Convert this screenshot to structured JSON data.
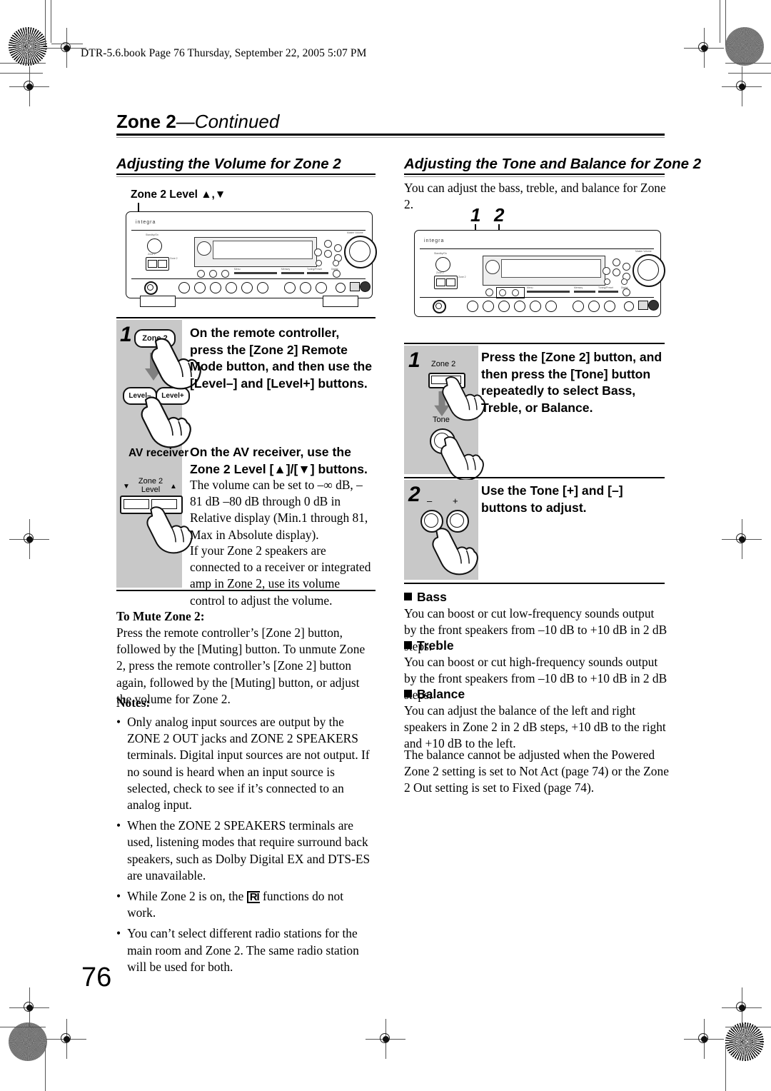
{
  "page": {
    "file_header": "DTR-5.6.book  Page 76  Thursday, September 22, 2005  5:07 PM",
    "chapter_title_bold": "Zone 2",
    "chapter_title_italic": "—Continued",
    "page_number": "76"
  },
  "left_column": {
    "section_title": "Adjusting the Volume for Zone 2",
    "figure_callout": "Zone 2 Level ▲,▼",
    "receiver_logo": "integra",
    "step1": {
      "number": "1",
      "remote_button_top": "Zone 2",
      "remote_button_left": "Level–",
      "remote_button_right": "Level+",
      "device_label": "AV receiver",
      "receiver_button_label_line1": "Zone 2",
      "receiver_button_label_line2": "Level",
      "receiver_button_down": "▼",
      "receiver_button_up": "▲",
      "instruction_remote": "On the remote controller, press the [Zone 2] Remote Mode button, and then use the [Level–] and [Level+] buttons.",
      "instruction_receiver": "On the AV receiver, use the Zone 2 Level [▲]/[▼] buttons.",
      "detail_paragraph_1": "The volume can be set to –∞ dB, –81 dB –80 dB through 0 dB in Relative display (Min.1 through 81, Max in Absolute display).",
      "detail_paragraph_2": "If your Zone 2 speakers are connected to a receiver or integrated amp in Zone 2, use its volume control to adjust the volume."
    },
    "mute": {
      "heading": "To Mute Zone 2:",
      "body": "Press the remote controller’s [Zone 2] button, followed by the [Muting] button. To unmute Zone 2, press the remote controller’s [Zone 2] button again, followed by the [Muting] button, or adjust the volume for Zone 2."
    },
    "notes": {
      "heading": "Notes:",
      "items": [
        "Only analog input sources are output by the ZONE 2 OUT jacks and ZONE 2 SPEAKERS terminals. Digital input sources are not output. If no sound is heard when an input source is selected, check to see if it’s connected to an analog input.",
        "When the ZONE 2 SPEAKERS terminals are used, listening modes that require surround back speakers, such as Dolby Digital EX and DTS-ES are unavailable.",
        "While Zone 2 is on, the  RI  functions do not work.",
        "You can’t select different radio stations for the main room and Zone 2. The same radio station will be used for both."
      ],
      "ri_logo_text": "RI"
    }
  },
  "right_column": {
    "section_title": "Adjusting the Tone and Balance for Zone 2",
    "intro": "You can adjust the bass, treble, and balance for Zone 2.",
    "figure_callout_1": "1",
    "figure_callout_2": "2",
    "receiver_logo": "integra",
    "step1": {
      "number": "1",
      "button_label_top": "Zone 2",
      "button_label_bottom": "Tone",
      "instruction": "Press the [Zone 2] button, and then press the [Tone] button repeatedly to select Bass, Treble, or Balance."
    },
    "step2": {
      "number": "2",
      "minus_label": "–",
      "plus_label": "+",
      "instruction": "Use the Tone [+] and [–] buttons to adjust."
    },
    "topics": [
      {
        "heading": "Bass",
        "body": "You can boost or cut low-frequency sounds output by the front speakers from –10 dB to +10 dB in 2 dB steps."
      },
      {
        "heading": "Treble",
        "body": "You can boost or cut high-frequency sounds output by the front speakers from –10 dB to +10 dB in 2 dB steps."
      },
      {
        "heading": "Balance",
        "body": "You can adjust the balance of the left and right speakers in Zone 2 in 2 dB steps, +10 dB to the right and +10 dB to the left."
      }
    ],
    "balance_note": "The balance cannot be adjusted when the Powered Zone 2 setting is set to Not Act (page 74) or the Zone 2 Out setting is set to Fixed (page 74)."
  }
}
